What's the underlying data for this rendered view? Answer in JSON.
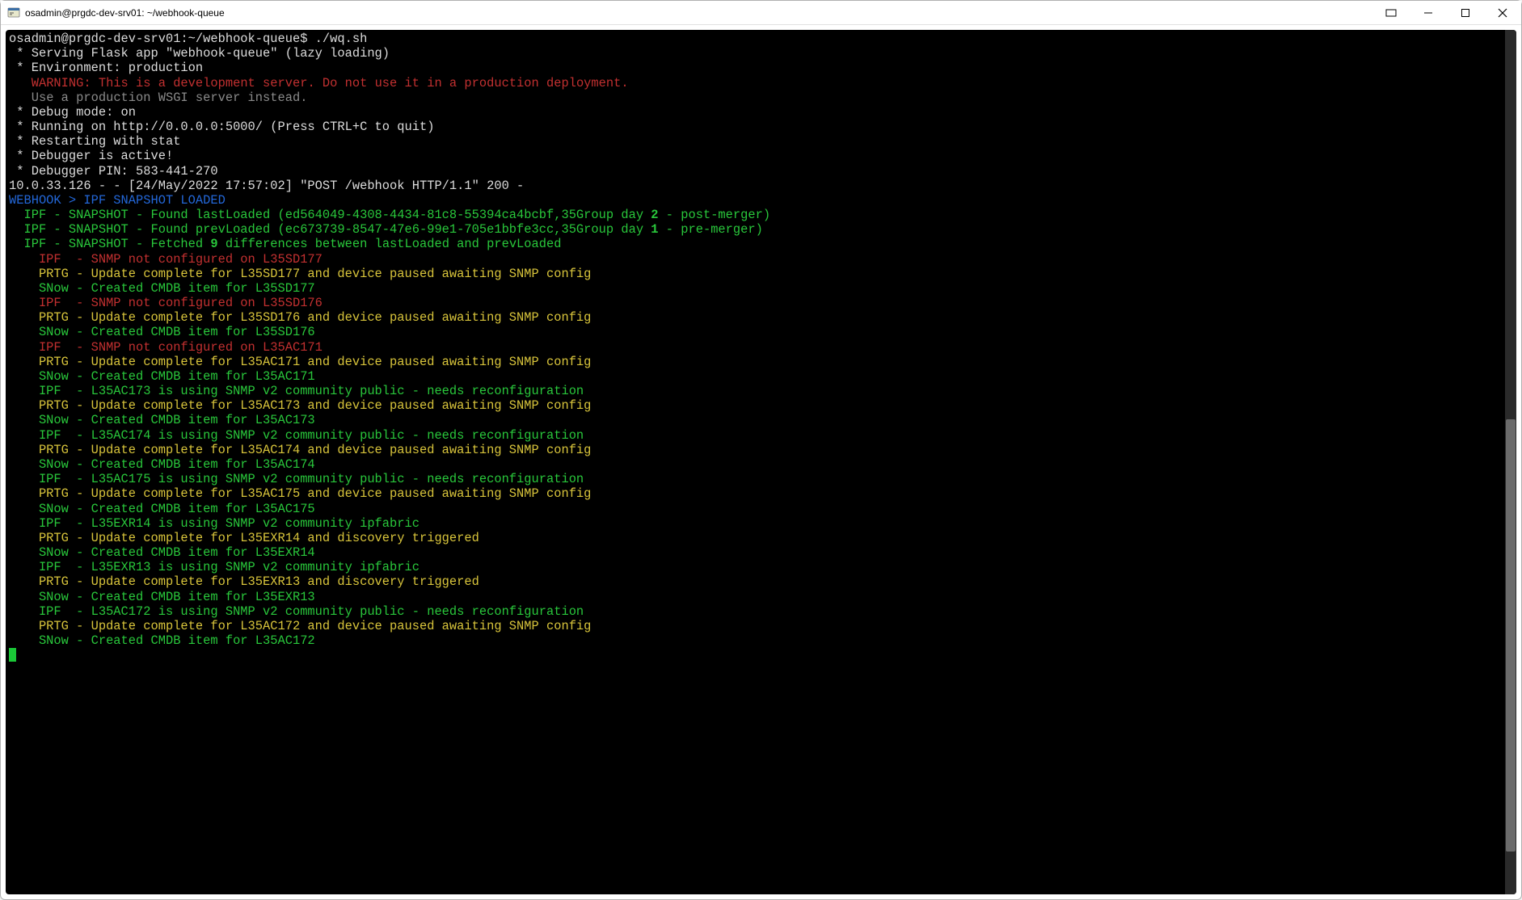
{
  "window": {
    "title": "osadmin@prgdc-dev-srv01: ~/webhook-queue"
  },
  "lines": [
    {
      "indent": 0,
      "parts": [
        {
          "class": "c-default",
          "text": "osadmin@prgdc-dev-srv01:~/webhook-queue$ ./wq.sh"
        }
      ]
    },
    {
      "indent": 0,
      "parts": [
        {
          "class": "c-default",
          "text": " * Serving Flask app \"webhook-queue\" (lazy loading)"
        }
      ]
    },
    {
      "indent": 0,
      "parts": [
        {
          "class": "c-default",
          "text": " * Environment: production"
        }
      ]
    },
    {
      "indent": 0,
      "parts": [
        {
          "class": "c-default",
          "text": "   "
        },
        {
          "class": "c-red",
          "text": "WARNING: This is a development server. Do not use it in a production deployment."
        }
      ]
    },
    {
      "indent": 0,
      "parts": [
        {
          "class": "c-default",
          "text": "   "
        },
        {
          "class": "c-gray",
          "text": "Use a production WSGI server instead."
        }
      ]
    },
    {
      "indent": 0,
      "parts": [
        {
          "class": "c-default",
          "text": " * Debug mode: on"
        }
      ]
    },
    {
      "indent": 0,
      "parts": [
        {
          "class": "c-default",
          "text": " * Running on http://0.0.0.0:5000/ (Press CTRL+C to quit)"
        }
      ]
    },
    {
      "indent": 0,
      "parts": [
        {
          "class": "c-default",
          "text": " * Restarting with stat"
        }
      ]
    },
    {
      "indent": 0,
      "parts": [
        {
          "class": "c-default",
          "text": " * Debugger is active!"
        }
      ]
    },
    {
      "indent": 0,
      "parts": [
        {
          "class": "c-default",
          "text": " * Debugger PIN: 583-441-270"
        }
      ]
    },
    {
      "indent": 0,
      "parts": [
        {
          "class": "c-default",
          "text": "10.0.33.126 - - [24/May/2022 17:57:02] \"POST /webhook HTTP/1.1\" 200 -"
        }
      ]
    },
    {
      "indent": 0,
      "parts": [
        {
          "class": "c-blue",
          "text": "WEBHOOK > IPF SNAPSHOT LOADED"
        }
      ]
    },
    {
      "indent": 0,
      "parts": [
        {
          "class": "c-green",
          "text": "  IPF - SNAPSHOT - Found lastLoaded (ed564049-4308-4434-81c8-55394ca4bcbf,35Group day "
        },
        {
          "class": "c-green bold-num",
          "text": "2"
        },
        {
          "class": "c-green",
          "text": " - post-merger)"
        }
      ]
    },
    {
      "indent": 0,
      "parts": [
        {
          "class": "c-green",
          "text": "  IPF - SNAPSHOT - Found prevLoaded (ec673739-8547-47e6-99e1-705e1bbfe3cc,35Group day "
        },
        {
          "class": "c-green bold-num",
          "text": "1"
        },
        {
          "class": "c-green",
          "text": " - pre-merger)"
        }
      ]
    },
    {
      "indent": 0,
      "parts": [
        {
          "class": "c-green",
          "text": "  IPF - SNAPSHOT - Fetched "
        },
        {
          "class": "c-green bold-num",
          "text": "9"
        },
        {
          "class": "c-green",
          "text": " differences between lastLoaded and prevLoaded"
        }
      ]
    },
    {
      "indent": 0,
      "parts": [
        {
          "class": "c-red",
          "text": "    IPF  - SNMP not configured on L35SD177"
        }
      ]
    },
    {
      "indent": 0,
      "parts": [
        {
          "class": "c-yellow",
          "text": "    PRTG - Update complete for L35SD177 and device paused awaiting SNMP config"
        }
      ]
    },
    {
      "indent": 0,
      "parts": [
        {
          "class": "c-green",
          "text": "    SNow - Created CMDB item for L35SD177"
        }
      ]
    },
    {
      "indent": 0,
      "parts": [
        {
          "class": "c-red",
          "text": "    IPF  - SNMP not configured on L35SD176"
        }
      ]
    },
    {
      "indent": 0,
      "parts": [
        {
          "class": "c-yellow",
          "text": "    PRTG - Update complete for L35SD176 and device paused awaiting SNMP config"
        }
      ]
    },
    {
      "indent": 0,
      "parts": [
        {
          "class": "c-green",
          "text": "    SNow - Created CMDB item for L35SD176"
        }
      ]
    },
    {
      "indent": 0,
      "parts": [
        {
          "class": "c-red",
          "text": "    IPF  - SNMP not configured on L35AC171"
        }
      ]
    },
    {
      "indent": 0,
      "parts": [
        {
          "class": "c-yellow",
          "text": "    PRTG - Update complete for L35AC171 and device paused awaiting SNMP config"
        }
      ]
    },
    {
      "indent": 0,
      "parts": [
        {
          "class": "c-green",
          "text": "    SNow - Created CMDB item for L35AC171"
        }
      ]
    },
    {
      "indent": 0,
      "parts": [
        {
          "class": "c-green",
          "text": "    IPF  - L35AC173 is using SNMP v2 community public - needs reconfiguration"
        }
      ]
    },
    {
      "indent": 0,
      "parts": [
        {
          "class": "c-yellow",
          "text": "    PRTG - Update complete for L35AC173 and device paused awaiting SNMP config"
        }
      ]
    },
    {
      "indent": 0,
      "parts": [
        {
          "class": "c-green",
          "text": "    SNow - Created CMDB item for L35AC173"
        }
      ]
    },
    {
      "indent": 0,
      "parts": [
        {
          "class": "c-green",
          "text": "    IPF  - L35AC174 is using SNMP v2 community public - needs reconfiguration"
        }
      ]
    },
    {
      "indent": 0,
      "parts": [
        {
          "class": "c-yellow",
          "text": "    PRTG - Update complete for L35AC174 and device paused awaiting SNMP config"
        }
      ]
    },
    {
      "indent": 0,
      "parts": [
        {
          "class": "c-green",
          "text": "    SNow - Created CMDB item for L35AC174"
        }
      ]
    },
    {
      "indent": 0,
      "parts": [
        {
          "class": "c-green",
          "text": "    IPF  - L35AC175 is using SNMP v2 community public - needs reconfiguration"
        }
      ]
    },
    {
      "indent": 0,
      "parts": [
        {
          "class": "c-yellow",
          "text": "    PRTG - Update complete for L35AC175 and device paused awaiting SNMP config"
        }
      ]
    },
    {
      "indent": 0,
      "parts": [
        {
          "class": "c-green",
          "text": "    SNow - Created CMDB item for L35AC175"
        }
      ]
    },
    {
      "indent": 0,
      "parts": [
        {
          "class": "c-green",
          "text": "    IPF  - L35EXR14 is using SNMP v2 community ipfabric"
        }
      ]
    },
    {
      "indent": 0,
      "parts": [
        {
          "class": "c-yellow",
          "text": "    PRTG - Update complete for L35EXR14 and discovery triggered"
        }
      ]
    },
    {
      "indent": 0,
      "parts": [
        {
          "class": "c-green",
          "text": "    SNow - Created CMDB item for L35EXR14"
        }
      ]
    },
    {
      "indent": 0,
      "parts": [
        {
          "class": "c-green",
          "text": "    IPF  - L35EXR13 is using SNMP v2 community ipfabric"
        }
      ]
    },
    {
      "indent": 0,
      "parts": [
        {
          "class": "c-yellow",
          "text": "    PRTG - Update complete for L35EXR13 and discovery triggered"
        }
      ]
    },
    {
      "indent": 0,
      "parts": [
        {
          "class": "c-green",
          "text": "    SNow - Created CMDB item for L35EXR13"
        }
      ]
    },
    {
      "indent": 0,
      "parts": [
        {
          "class": "c-green",
          "text": "    IPF  - L35AC172 is using SNMP v2 community public - needs reconfiguration"
        }
      ]
    },
    {
      "indent": 0,
      "parts": [
        {
          "class": "c-yellow",
          "text": "    PRTG - Update complete for L35AC172 and device paused awaiting SNMP config"
        }
      ]
    },
    {
      "indent": 0,
      "parts": [
        {
          "class": "c-green",
          "text": "    SNow - Created CMDB item for L35AC172"
        }
      ]
    }
  ],
  "scrollbar": {
    "thumb_top_pct": 45,
    "thumb_height_pct": 50
  }
}
